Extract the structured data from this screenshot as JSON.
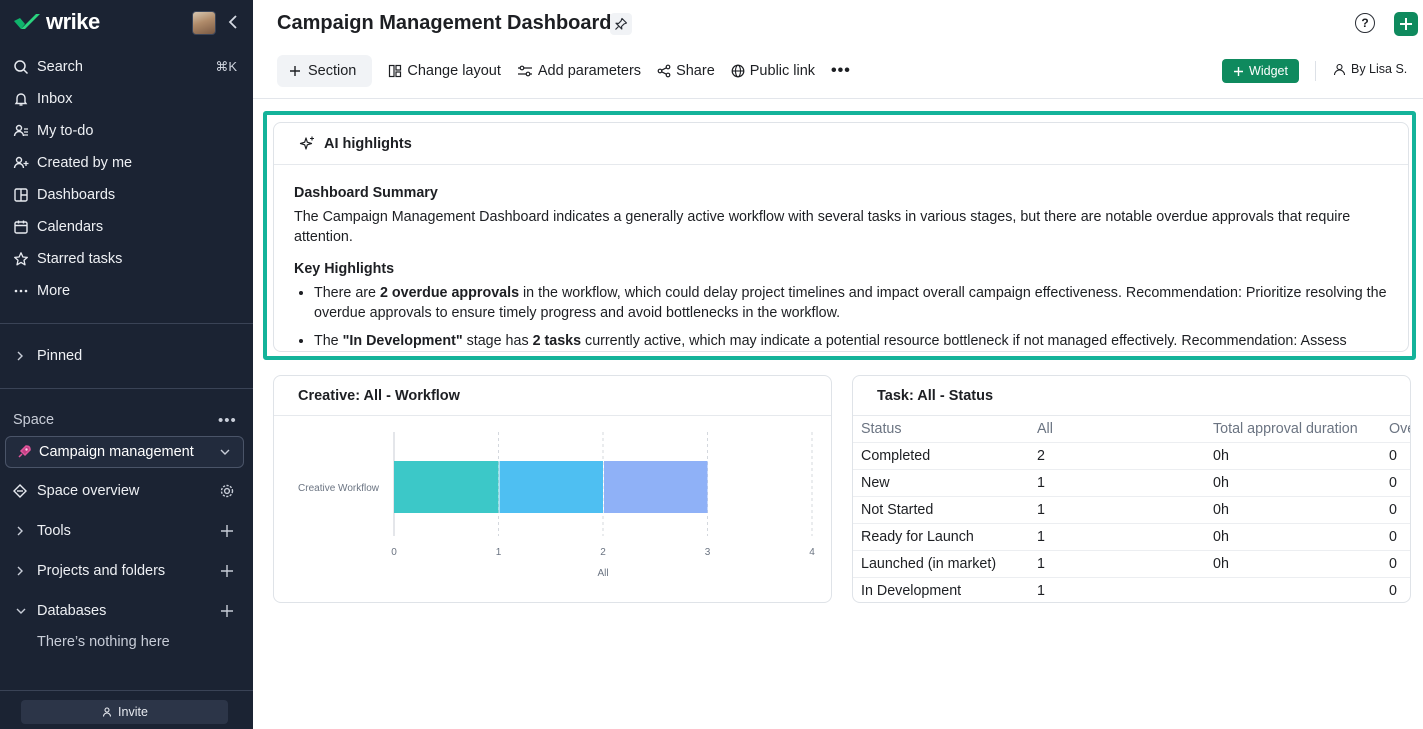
{
  "sidebar": {
    "logo": "wrike",
    "nav": [
      {
        "label": "Search",
        "icon": "search-icon",
        "shortcut": "⌘K"
      },
      {
        "label": "Inbox",
        "icon": "bell-icon"
      },
      {
        "label": "My to-do",
        "icon": "user-list-icon"
      },
      {
        "label": "Created by me",
        "icon": "user-plus-icon"
      },
      {
        "label": "Dashboards",
        "icon": "dashboard-icon"
      },
      {
        "label": "Calendars",
        "icon": "calendar-icon"
      },
      {
        "label": "Starred tasks",
        "icon": "star-icon"
      },
      {
        "label": "More",
        "icon": "more-icon"
      }
    ],
    "pinned_label": "Pinned",
    "space_label": "Space",
    "space_selected": "Campaign management",
    "space_overview": "Space overview",
    "tools": "Tools",
    "projects": "Projects and folders",
    "databases": "Databases",
    "databases_empty": "There’s nothing here",
    "invite": "Invite"
  },
  "header": {
    "title": "Campaign Management Dashboard",
    "help_glyph": "?"
  },
  "toolbar": {
    "section": "Section",
    "change_layout": "Change layout",
    "add_parameters": "Add parameters",
    "share": "Share",
    "public_link": "Public link",
    "more": "•••",
    "widget": "Widget",
    "by": "By Lisa S."
  },
  "ai": {
    "title": "AI highlights",
    "summary_heading": "Dashboard Summary",
    "summary_text": "The Campaign Management Dashboard indicates a generally active workflow with several tasks in various stages, but there are notable overdue approvals that require attention.",
    "key_heading": "Key Highlights",
    "b1_pre": "There are ",
    "b1_bold": "2 overdue approvals",
    "b1_post": " in the workflow, which could delay project timelines and impact overall campaign effectiveness. Recommendation: Prioritize resolving the overdue approvals to ensure timely progress and avoid bottlenecks in the workflow.",
    "b2_pre": "The ",
    "b2_bold1": "\"In Development\"",
    "b2_mid": " stage has ",
    "b2_bold2": "2 tasks",
    "b2_post": " currently active, which may indicate a potential resource bottleneck if not managed effectively. Recommendation: Assess"
  },
  "chart_card": {
    "title": "Creative: All - Workflow"
  },
  "chart_data": {
    "type": "bar",
    "orientation": "horizontal",
    "stacked": true,
    "categories": [
      "Creative Workflow"
    ],
    "series": [
      {
        "values": [
          1
        ],
        "color": "#3cc8c8"
      },
      {
        "values": [
          1
        ],
        "color": "#4ebff2"
      },
      {
        "values": [
          1
        ],
        "color": "#8fb1f7"
      }
    ],
    "xlabel": "All",
    "xlim": [
      0,
      4
    ],
    "xticks": [
      "0",
      "1",
      "2",
      "3",
      "4"
    ],
    "grid": true
  },
  "table_card": {
    "title": "Task: All - Status",
    "columns": [
      "Status",
      "All",
      "Total approval duration",
      "Ove"
    ],
    "rows": [
      [
        "Completed",
        "2",
        "0h",
        "0"
      ],
      [
        "New",
        "1",
        "0h",
        "0"
      ],
      [
        "Not Started",
        "1",
        "0h",
        "0"
      ],
      [
        "Ready for Launch",
        "1",
        "0h",
        "0"
      ],
      [
        "Launched (in market)",
        "1",
        "0h",
        "0"
      ],
      [
        "In Development",
        "1",
        "",
        "0"
      ]
    ]
  }
}
